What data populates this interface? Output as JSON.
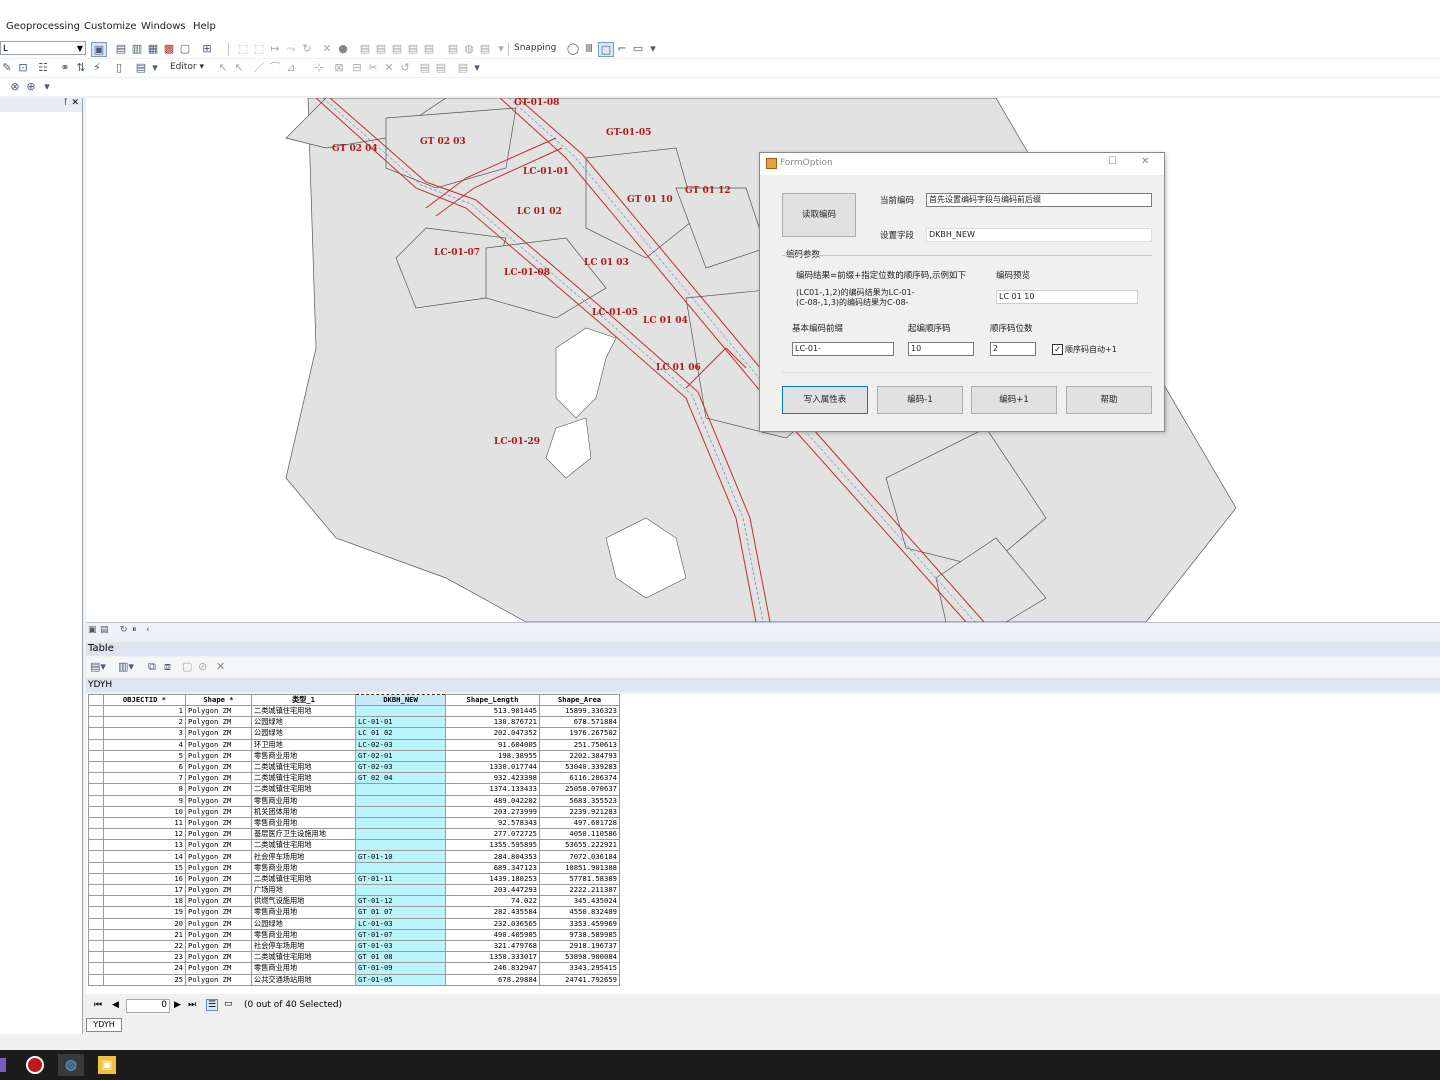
{
  "menu": {
    "items": [
      "Geoprocessing",
      "Customize",
      "Windows",
      "Help"
    ]
  },
  "toolbar": {
    "layer_combo": "L",
    "snapping_label": "Snapping",
    "editor_label": "Editor"
  },
  "map": {
    "labels": [
      "GT-01-08",
      "GT-01-05",
      "GT 02 04",
      "GT 02 03",
      "LC-01-01",
      "GT 01 12",
      "GT 01 10",
      "LC 01 02",
      "LC-01-07",
      "LC-01-08",
      "LC 01 03",
      "LC-01-05",
      "LC 01 04",
      "LC 01 06",
      "LC-01-29"
    ]
  },
  "table": {
    "window_title": "Table",
    "layer_name": "YDYH",
    "columns": [
      "OBJECTID *",
      "Shape *",
      "类型_1",
      "DKBH_NEW",
      "Shape_Length",
      "Shape_Area"
    ],
    "rows": [
      [
        "1",
        "Polygon ZM",
        "二类城镇住宅用地",
        "",
        "513.901445",
        "15899.336323"
      ],
      [
        "2",
        "Polygon ZM",
        "公园绿地",
        "LC-01-01",
        "130.876721",
        "678.571884"
      ],
      [
        "3",
        "Polygon ZM",
        "公园绿地",
        "LC 01 02",
        "202.047352",
        "1976.267502"
      ],
      [
        "4",
        "Polygon ZM",
        "环卫用地",
        "LC-02-03",
        "91.604005",
        "251.750613"
      ],
      [
        "5",
        "Polygon ZM",
        "零售商业用地",
        "GT-02-01",
        "198.38955",
        "2202.384793"
      ],
      [
        "6",
        "Polygon ZM",
        "二类城镇住宅用地",
        "GT-02-03",
        "1330.017744",
        "53040.339283"
      ],
      [
        "7",
        "Polygon ZM",
        "二类城镇住宅用地",
        "GT 02 04",
        "932.423398",
        "6116.206374"
      ],
      [
        "8",
        "Polygon ZM",
        "二类城镇住宅用地",
        "",
        "1374.133433",
        "25058.070637"
      ],
      [
        "9",
        "Polygon ZM",
        "零售商业用地",
        "",
        "489.042202",
        "5683.355523"
      ],
      [
        "10",
        "Polygon ZM",
        "机关团体用地",
        "",
        "203.273999",
        "2239.921283"
      ],
      [
        "11",
        "Polygon ZM",
        "零售商业用地",
        "",
        "92.578343",
        "497.601728"
      ],
      [
        "12",
        "Polygon ZM",
        "基层医疗卫生设施用地",
        "",
        "277.072725",
        "4050.110586"
      ],
      [
        "13",
        "Polygon ZM",
        "二类城镇住宅用地",
        "",
        "1355.595895",
        "53655.222921"
      ],
      [
        "14",
        "Polygon ZM",
        "社会停车场用地",
        "GT-01-10",
        "284.804353",
        "7072.036184"
      ],
      [
        "15",
        "Polygon ZM",
        "零售商业用地",
        "",
        "689.347123",
        "10851.901388"
      ],
      [
        "16",
        "Polygon ZM",
        "二类城镇住宅用地",
        "GT-01-11",
        "1439.180253",
        "57781.58389"
      ],
      [
        "17",
        "Polygon ZM",
        "广场用地",
        "",
        "203.447293",
        "2222.211387"
      ],
      [
        "18",
        "Polygon ZM",
        "供燃气设施用地",
        "GT-01-12",
        "74.022",
        "345.435024"
      ],
      [
        "19",
        "Polygon ZM",
        "零售商业用地",
        "GT 01 07",
        "282.435584",
        "4550.832489"
      ],
      [
        "20",
        "Polygon ZM",
        "公园绿地",
        "LC-01-03",
        "232.036565",
        "3353.459969"
      ],
      [
        "21",
        "Polygon ZM",
        "零售商业用地",
        "GT-01-07",
        "490.405905",
        "9738.589985"
      ],
      [
        "22",
        "Polygon ZM",
        "社会停车场用地",
        "GT-01-03",
        "321.479768",
        "2918.196737"
      ],
      [
        "23",
        "Polygon ZM",
        "二类城镇住宅用地",
        "GT 01 08",
        "1350.333017",
        "53898.900084"
      ],
      [
        "24",
        "Polygon ZM",
        "零售商业用地",
        "GT-01-09",
        "246.832947",
        "3343.295415"
      ],
      [
        "25",
        "Polygon ZM",
        "公共交通场站用地",
        "GT-01-05",
        "678.29884",
        "24741.792659"
      ]
    ],
    "nav_position": "0",
    "selection_status": "(0 out of 40 Selected)",
    "bottom_tab": "YDYH"
  },
  "dialog": {
    "title": "FormOption",
    "read_button": "读取编码",
    "current_encoding_label": "当前编码",
    "current_encoding_value": "首先设置编码字段与编码前后缀",
    "set_field_label": "设置字段",
    "set_field_value": "DKBH_NEW",
    "params_group_label": "编码参数",
    "hint_line1": "编码结果=前缀+指定位数的顺序码,示例如下",
    "hint_line2": "(LC01-,1,2)的编码结果为LC-01-",
    "hint_line3": "(C-08-,1,3)的编码结果为C-08-",
    "preview_label": "编码预览",
    "preview_value": "LC 01 10",
    "prefix_label": "基本编码前缀",
    "prefix_value": "LC-01-",
    "start_label": "起编顺序码",
    "start_value": "10",
    "digits_label": "顺序码位数",
    "digits_value": "2",
    "auto_increment_label": "顺序码自动+1",
    "auto_increment_checked": true,
    "write_button": "写入属性表",
    "dec_button": "编码-1",
    "inc_button": "编码+1",
    "help_button": "帮助"
  }
}
